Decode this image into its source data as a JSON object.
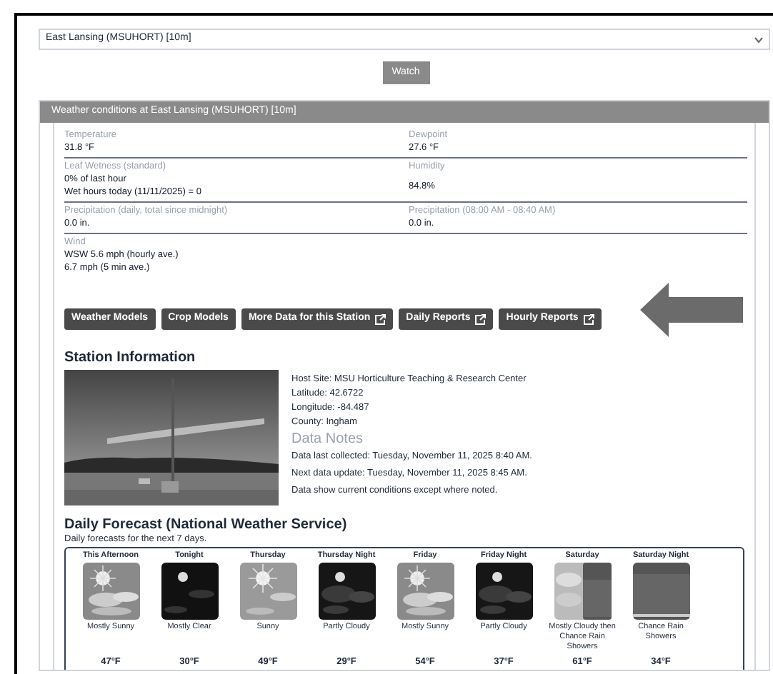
{
  "station_select": {
    "value": "East Lansing (MSUHORT) [10m]"
  },
  "watch_button": {
    "label": "Watch"
  },
  "conditions": {
    "title": "Weather conditions at East Lansing (MSUHORT) [10m]",
    "fields": [
      {
        "label": "Temperature",
        "lines": [
          "31.8 °F"
        ]
      },
      {
        "label": "Dewpoint",
        "lines": [
          "27.6 °F"
        ]
      },
      {
        "label": "Leaf Wetness (standard)",
        "lines": [
          "0% of last hour",
          "Wet hours today (11/11/2025) = 0"
        ]
      },
      {
        "label": "Humidity",
        "lines": [
          "84.8%"
        ]
      },
      {
        "label": "Precipitation (daily, total since midnight)",
        "lines": [
          "0.0 in."
        ]
      },
      {
        "label": "Precipitation (08:00 AM - 08:40 AM)",
        "lines": [
          "0.0 in."
        ]
      },
      {
        "label": "Wind",
        "lines": [
          "WSW 5.6 mph (hourly ave.)",
          "6.7 mph (5 min ave.)"
        ]
      }
    ]
  },
  "buttons": [
    {
      "label": "Weather Models",
      "external": false
    },
    {
      "label": "Crop Models",
      "external": false
    },
    {
      "label": "More Data for this Station",
      "external": true
    },
    {
      "label": "Daily Reports",
      "external": true
    },
    {
      "label": "Hourly Reports",
      "external": true
    }
  ],
  "station_info": {
    "heading": "Station Information",
    "photo": {
      "kind": "picture"
    },
    "details": [
      "Host Site: MSU Horticulture Teaching & Research Center",
      "Latitude: 42.6722",
      "Longitude: -84.487",
      "County: Ingham"
    ],
    "notes_heading": "Data Notes",
    "notes": [
      "Data last collected: Tuesday, November 11, 2025 8:40 AM.",
      "Next data update: Tuesday, November 11, 2025 8:45 AM.",
      "Data show current conditions except where noted."
    ]
  },
  "forecast": {
    "heading": "Daily Forecast (National Weather Service)",
    "subtitle": "Daily forecasts for the next 7 days.",
    "periods": [
      {
        "name": "This Afternoon",
        "kind": "day_clouds",
        "condition": "Mostly Sunny",
        "temp": "47°F"
      },
      {
        "name": "Tonight",
        "kind": "night_clear",
        "condition": "Mostly Clear",
        "temp": "30°F"
      },
      {
        "name": "Thursday",
        "kind": "day_clear",
        "condition": "Sunny",
        "temp": "49°F"
      },
      {
        "name": "Thursday Night",
        "kind": "night_clouds",
        "condition": "Partly Cloudy",
        "temp": "29°F"
      },
      {
        "name": "Friday",
        "kind": "day_clouds",
        "condition": "Mostly Sunny",
        "temp": "54°F"
      },
      {
        "name": "Friday Night",
        "kind": "night_clouds",
        "condition": "Partly Cloudy",
        "temp": "37°F"
      },
      {
        "name": "Saturday",
        "kind": "cloud_rain",
        "condition": "Mostly Cloudy then Chance Rain Showers",
        "temp": "61°F"
      },
      {
        "name": "Saturday Night",
        "kind": "rain",
        "condition": "Chance Rain Showers",
        "temp": "34°F"
      }
    ]
  }
}
